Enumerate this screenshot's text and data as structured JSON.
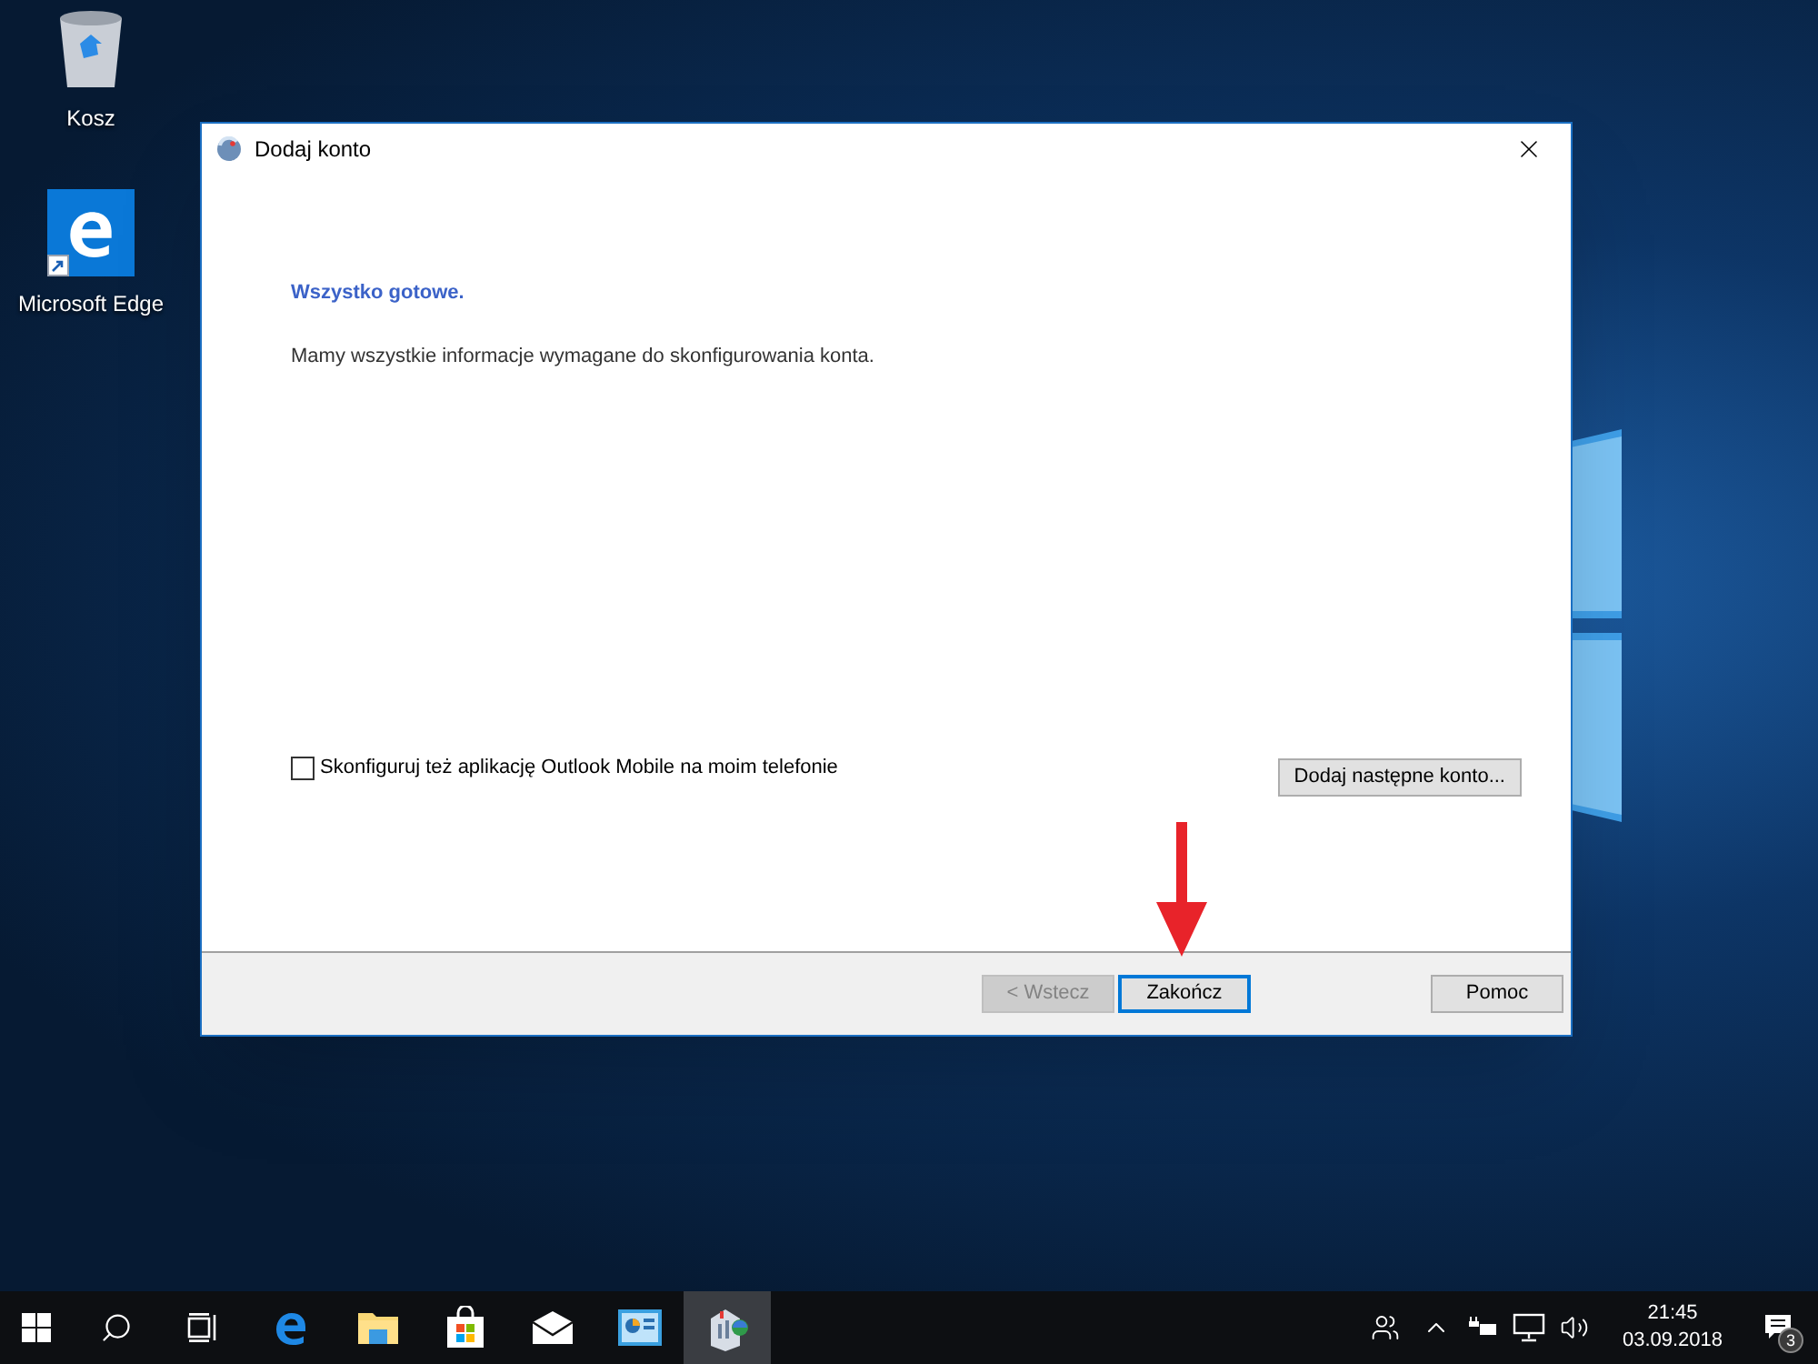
{
  "desktop_icons": [
    {
      "kind": "recycle-bin",
      "label": "Kosz"
    },
    {
      "kind": "edge",
      "label": "Microsoft Edge"
    }
  ],
  "dialog": {
    "title": "Dodaj konto",
    "heading": "Wszystko gotowe.",
    "message": "Mamy wszystkie informacje wymagane do skonfigurowania konta.",
    "checkbox": {
      "label": "Skonfiguruj też aplikację Outlook Mobile na moim telefonie",
      "checked": false
    },
    "side_button": "Dodaj następne konto...",
    "buttons": [
      {
        "label": "< Wstecz",
        "disabled": true,
        "default": false
      },
      {
        "label": "Zakończ",
        "disabled": false,
        "default": true
      },
      {
        "label": "Pomoc",
        "disabled": false,
        "default": false
      }
    ]
  },
  "taskbar": {
    "pinned": [
      {
        "kind": "edge",
        "active": false
      },
      {
        "kind": "folder",
        "active": false
      },
      {
        "kind": "store",
        "active": false
      },
      {
        "kind": "mail",
        "active": false
      },
      {
        "kind": "control-panel",
        "active": false
      },
      {
        "kind": "account-setup",
        "active": true
      }
    ],
    "time": "21:45",
    "date": "03.09.2018",
    "notification_count": "3"
  }
}
